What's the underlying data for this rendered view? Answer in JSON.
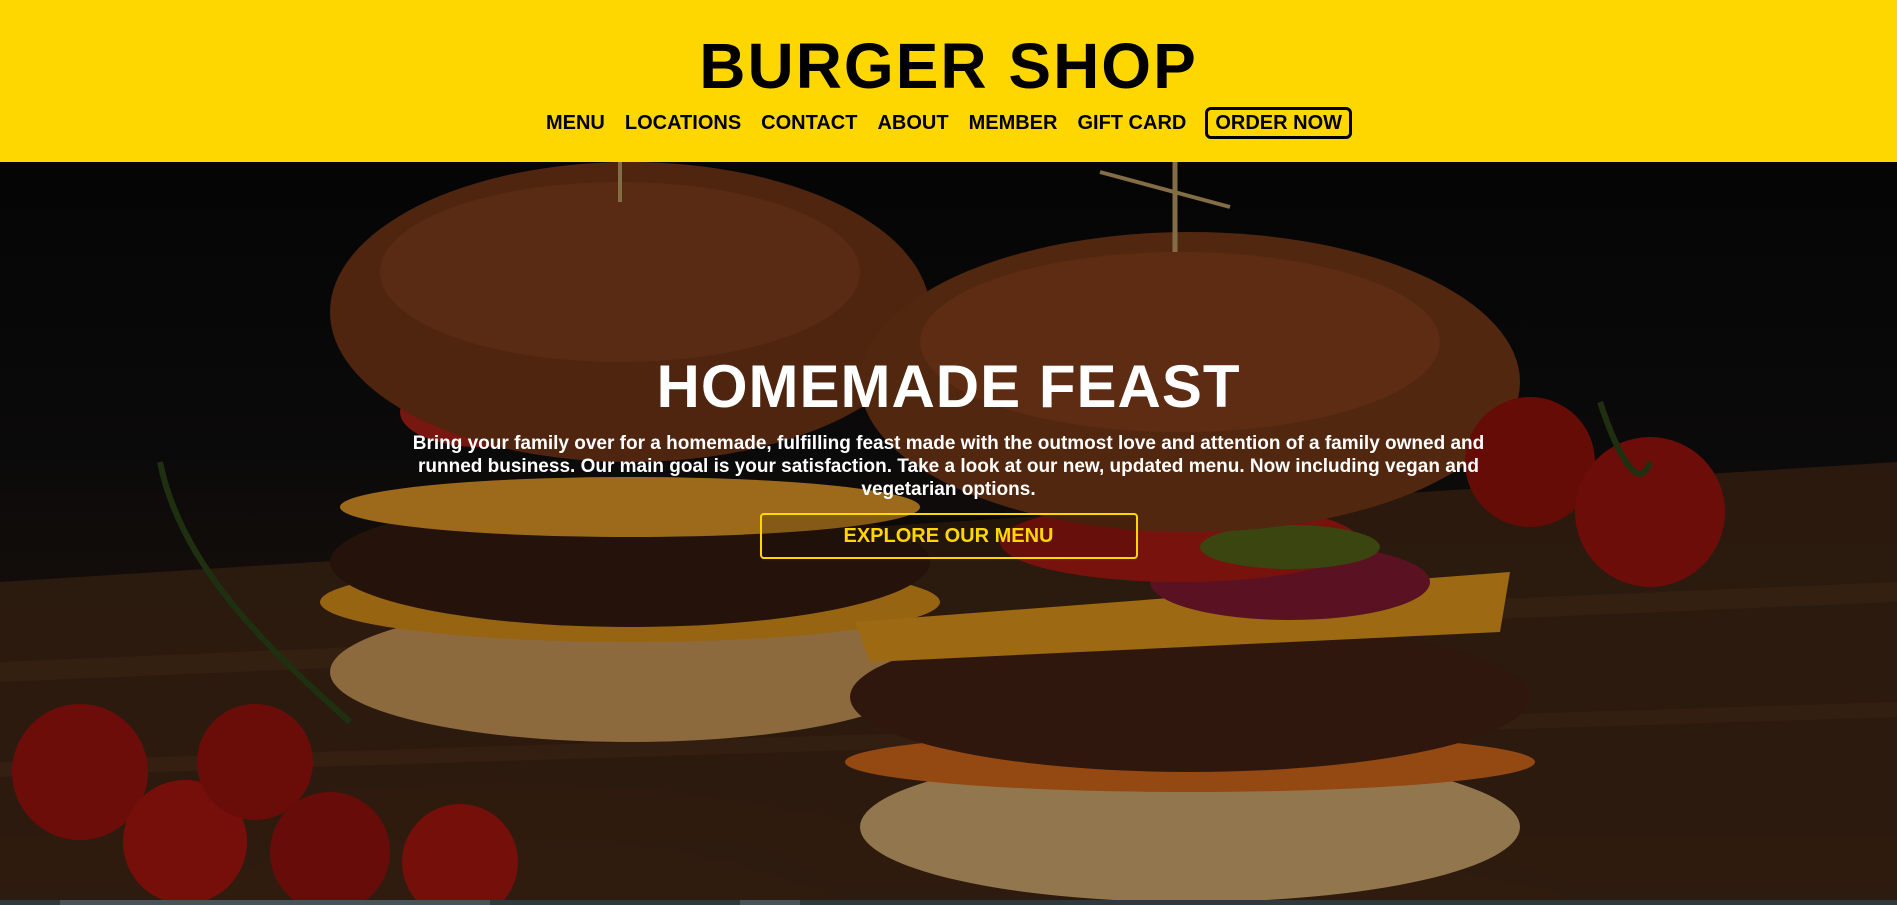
{
  "header": {
    "title": "BURGER SHOP",
    "nav": [
      {
        "label": "MENU"
      },
      {
        "label": "LOCATIONS"
      },
      {
        "label": "CONTACT"
      },
      {
        "label": "ABOUT"
      },
      {
        "label": "MEMBER"
      },
      {
        "label": "GIFT CARD"
      },
      {
        "label": "ORDER NOW"
      }
    ]
  },
  "hero": {
    "title": "HOMEMADE FEAST",
    "description": "Bring your family over for a homemade, fulfilling feast made with the outmost love and attention of a family owned and runned business. Our main goal is your satisfaction. Take a look at our new, updated menu. Now including vegan and vegetarian options.",
    "cta_label": "EXPLORE OUR MENU",
    "image_icon": "burger-photo"
  },
  "colors": {
    "brand_yellow": "#FFD700",
    "text_dark": "#000000",
    "text_light": "#FFFFFF"
  }
}
